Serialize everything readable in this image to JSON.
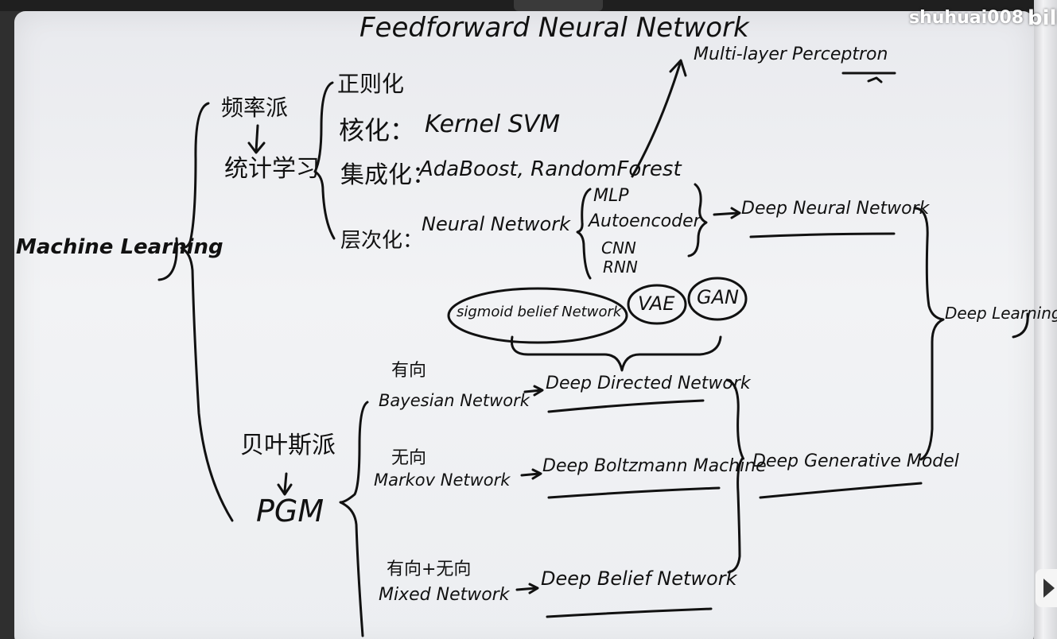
{
  "title": "Feedforward Neural Network",
  "mlp_top": "Multi-layer Perceptron",
  "root": "Machine Learning",
  "frequentist": {
    "name": "频率派",
    "stat": "统计学习"
  },
  "methods": {
    "reg": "正则化",
    "kernel_cn": "核化：",
    "kernel_en": "Kernel SVM",
    "ens_cn": "集成化：",
    "ens_en": "AdaBoost, RandomForest",
    "layer_cn": "层次化：",
    "layer_en": "Neural Network"
  },
  "nn_list": [
    "MLP",
    "Autoencoder",
    "CNN",
    "RNN"
  ],
  "dnn": "Deep Neural Network",
  "ovals": [
    "sigmoid belief Network",
    "VAE",
    "GAN"
  ],
  "bayesian": {
    "name": "贝叶斯派",
    "pgm": "PGM"
  },
  "graphs": [
    {
      "cn": "有向",
      "en": "Bayesian Network",
      "deep": "Deep Directed Network"
    },
    {
      "cn": "无向",
      "en": "Markov Network",
      "deep": "Deep Boltzmann Machine"
    },
    {
      "cn": "有向+无向",
      "en": "Mixed Network",
      "deep": "Deep Belief Network"
    }
  ],
  "dgm": "Deep Generative Model",
  "dl": "Deep Learning",
  "watermark": "shuhuai008",
  "watermark_logo": "bili"
}
